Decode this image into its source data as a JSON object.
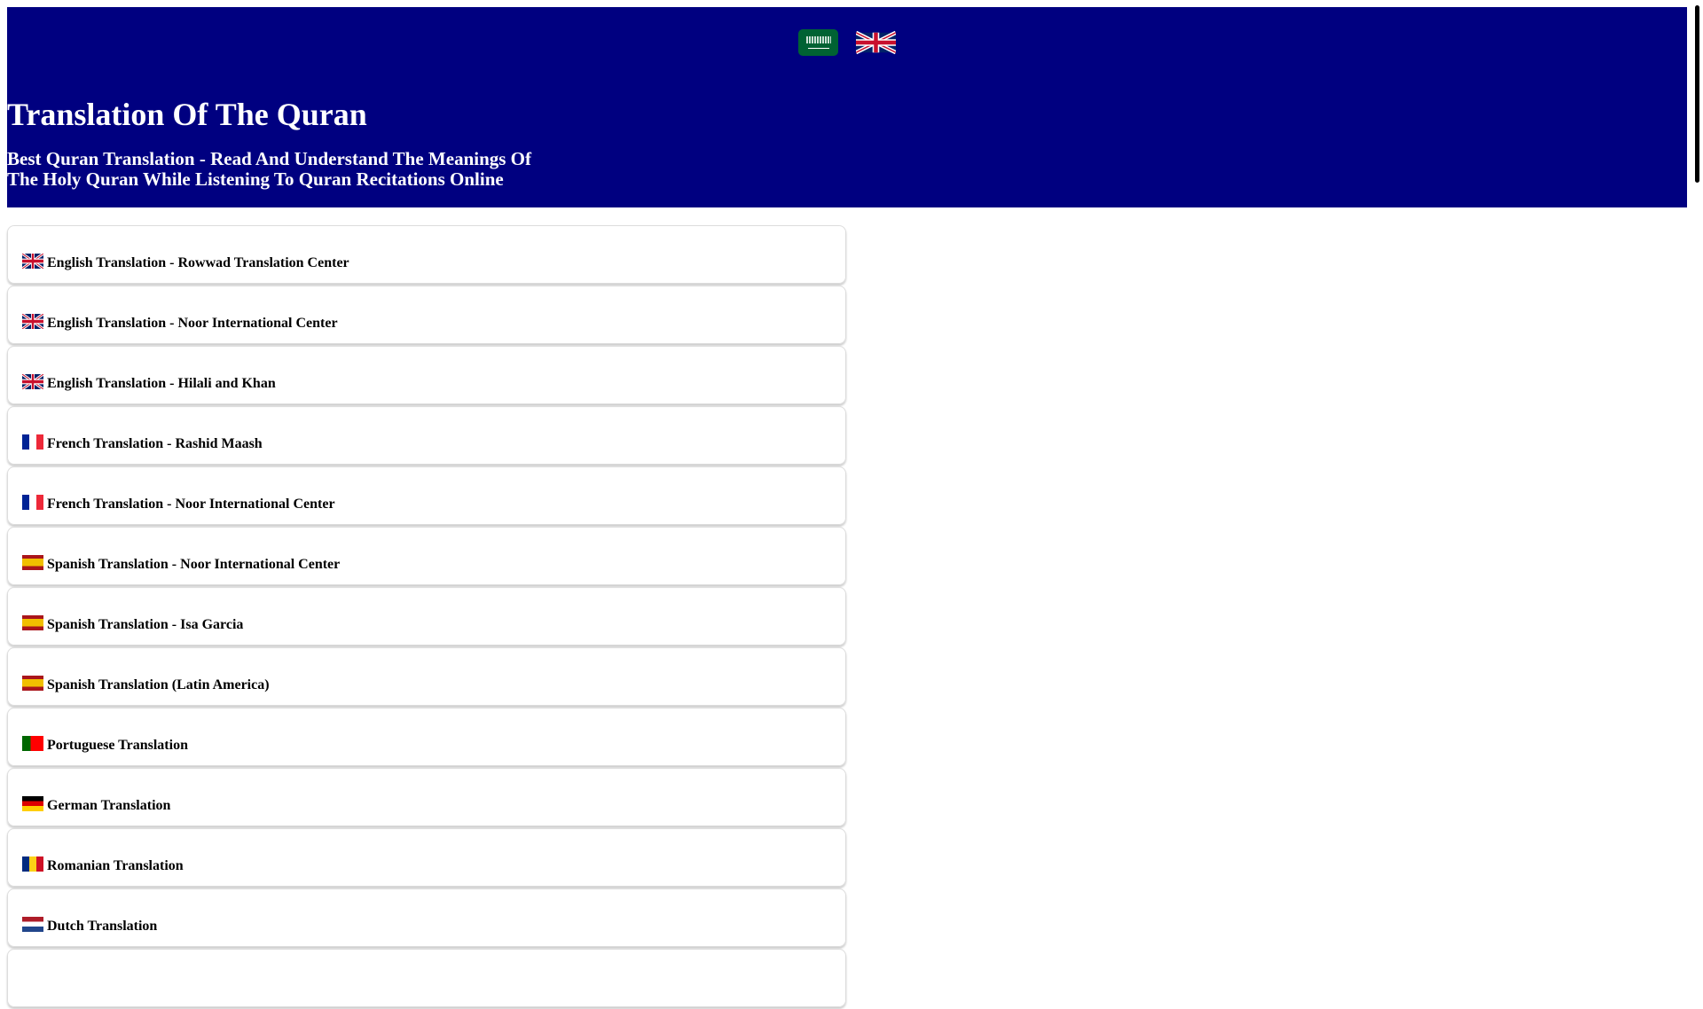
{
  "header": {
    "title": "Translation Of The Quran",
    "subtitle": "Best Quran Translation - Read And Understand The Meanings Of The Holy Quran While Listening To Quran Recitations Online",
    "bg": "#000080"
  },
  "languages": [
    {
      "icon": "saudi-flag-icon"
    },
    {
      "icon": "uk-flag-icon"
    }
  ],
  "items": [
    {
      "label": "English Translation - Rowwad Translation Center",
      "flag": "uk"
    },
    {
      "label": "English Translation - Noor International Center",
      "flag": "uk"
    },
    {
      "label": "English Translation - Hilali and Khan",
      "flag": "uk"
    },
    {
      "label": "French Translation - Rashid Maash",
      "flag": "fr"
    },
    {
      "label": "French Translation - Noor International Center",
      "flag": "fr"
    },
    {
      "label": "Spanish Translation - Noor International Center",
      "flag": "es"
    },
    {
      "label": "Spanish Translation - Isa Garcia",
      "flag": "es"
    },
    {
      "label": "Spanish Translation (Latin America)",
      "flag": "es"
    },
    {
      "label": "Portuguese Translation",
      "flag": "pt"
    },
    {
      "label": "German Translation",
      "flag": "de"
    },
    {
      "label": "Romanian Translation",
      "flag": "ro"
    },
    {
      "label": "Dutch Translation",
      "flag": "nl"
    },
    {
      "label": "",
      "flag": ""
    }
  ]
}
